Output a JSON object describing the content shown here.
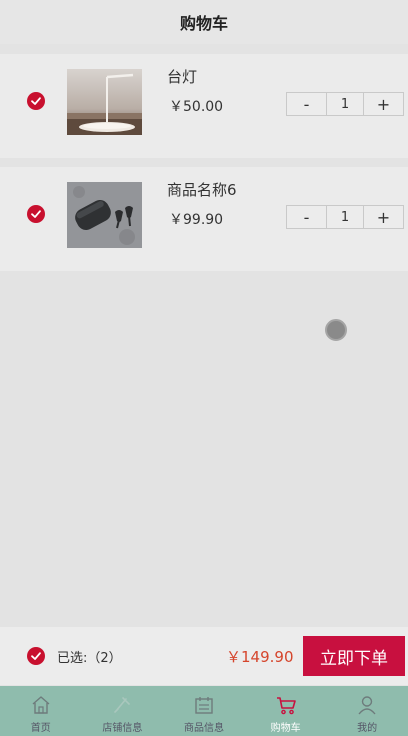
{
  "header": {
    "title": "购物车"
  },
  "cart": {
    "items": [
      {
        "name": "台灯",
        "price": "￥50.00",
        "qty": "1",
        "minus": "-",
        "plus": "+",
        "thumb_icon": "desk-lamp-image"
      },
      {
        "name": "商品名称6",
        "price": "￥99.90",
        "qty": "1",
        "minus": "-",
        "plus": "+",
        "thumb_icon": "earbuds-case-image"
      }
    ]
  },
  "checkout": {
    "selected_label": "已选:（2）",
    "total": "￥149.90",
    "order_button": "立即下单"
  },
  "tabbar": {
    "tabs": [
      {
        "label": "首页",
        "icon": "home-icon"
      },
      {
        "label": "店铺信息",
        "icon": "store-icon"
      },
      {
        "label": "商品信息",
        "icon": "calendar-icon"
      },
      {
        "label": "购物车",
        "icon": "cart-icon",
        "active": true
      },
      {
        "label": "我的",
        "icon": "user-icon"
      }
    ]
  },
  "colors": {
    "accent": "#c8102e",
    "order_button": "#c8103f",
    "total_price": "#d5452c",
    "tabbar": "#8fbcad"
  }
}
